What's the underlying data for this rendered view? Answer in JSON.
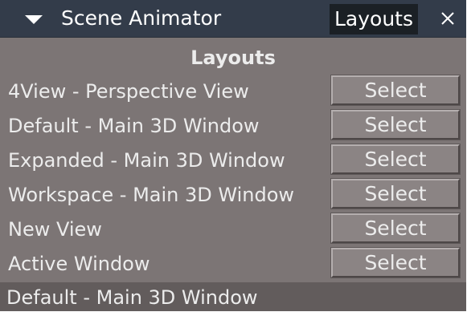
{
  "window": {
    "title": "Scene Animator",
    "tab_label": "Layouts",
    "collapse_icon": "triangle-down-icon",
    "close_icon": "close-icon"
  },
  "section": {
    "header": "Layouts"
  },
  "layouts": [
    {
      "name": "4View -  Perspective View",
      "button_label": "Select"
    },
    {
      "name": "Default - Main 3D Window",
      "button_label": "Select"
    },
    {
      "name": "Expanded - Main 3D Window",
      "button_label": "Select"
    },
    {
      "name": "Workspace - Main 3D Window",
      "button_label": "Select"
    },
    {
      "name": "New View",
      "button_label": "Select"
    },
    {
      "name": "Active Window",
      "button_label": "Select"
    }
  ],
  "status": {
    "current_layout": "Default -  Main 3D Window"
  },
  "colors": {
    "titlebar": "#333c4a",
    "panel": "#7c7575",
    "statusbar": "#625c5c",
    "text": "#ececec"
  }
}
